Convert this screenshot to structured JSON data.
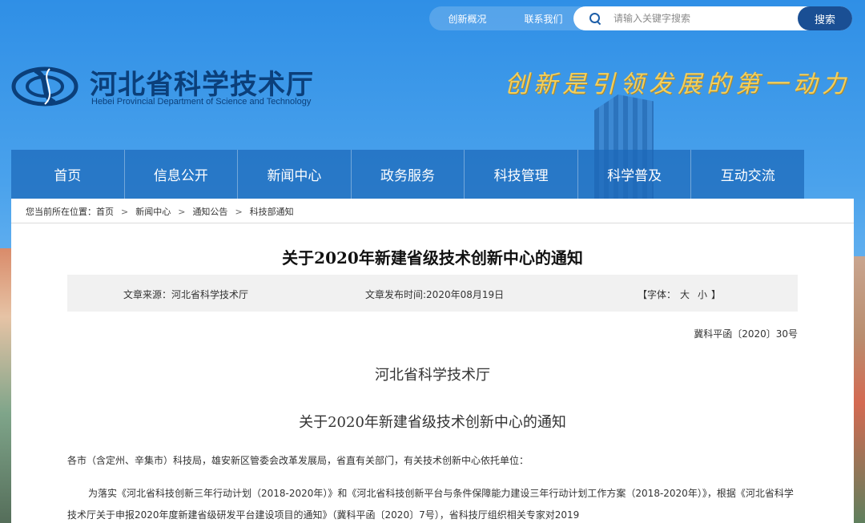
{
  "top_links": [
    "创新概况",
    "联系我们"
  ],
  "search": {
    "placeholder": "请输入关键字搜索",
    "button": "搜索"
  },
  "site": {
    "title_cn": "河北省科学技术厅",
    "title_en": "Hebei Provincial Department of Science and Technology",
    "slogan": "创新是引领发展的第一动力"
  },
  "nav": [
    "首页",
    "信息公开",
    "新闻中心",
    "政务服务",
    "科技管理",
    "科学普及",
    "互动交流"
  ],
  "breadcrumb": {
    "prefix": "您当前所在位置：",
    "items": [
      "首页",
      "新闻中心",
      "通知公告",
      "科技部通知"
    ],
    "separator": ">"
  },
  "article": {
    "title": "关于2020年新建省级技术创新中心的通知",
    "source": "文章来源：河北省科学技术厅",
    "date": "文章发布时间:2020年08月19日",
    "font_label": "【字体：",
    "font_large": "大",
    "font_small": "小",
    "font_end": "】",
    "doc_number": "冀科平函〔2020〕30号",
    "org": "河北省科学技术厅",
    "subtitle": "关于2020年新建省级技术创新中心的通知",
    "para1": "各市（含定州、辛集市）科技局，雄安新区管委会改革发展局，省直有关部门，有关技术创新中心依托单位：",
    "para2": "为落实《河北省科技创新三年行动计划（2018-2020年）》和《河北省科技创新平台与条件保障能力建设三年行动计划工作方案（2018-2020年）》，根据《河北省科学技术厅关于申报2020年度新建省级研发平台建设项目的通知》（冀科平函〔2020〕7号），省科技厅组织相关专家对2019"
  },
  "colors": {
    "nav_bg": "#1c68b8",
    "title_blue": "#0b3f7a",
    "slogan_gold": "#f1cf5e",
    "search_btn": "#1a4f94"
  }
}
